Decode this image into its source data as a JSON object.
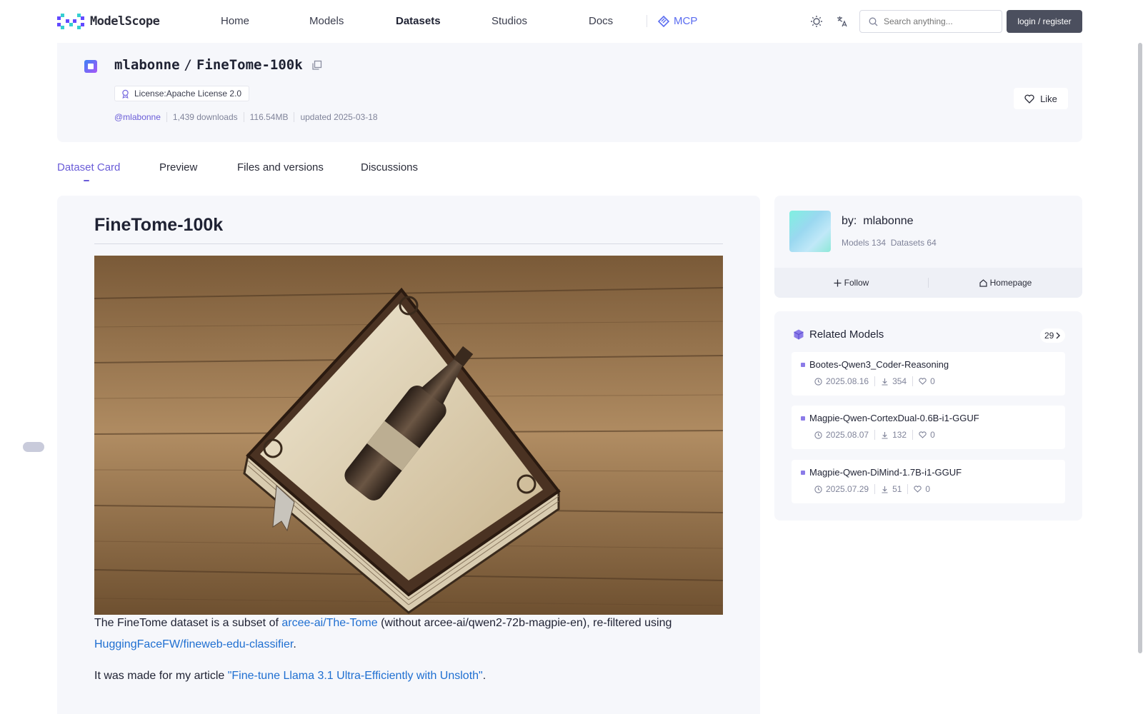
{
  "brand": {
    "name": "ModelScope"
  },
  "nav": {
    "items": [
      {
        "label": "Home"
      },
      {
        "label": "Models"
      },
      {
        "label": "Datasets"
      },
      {
        "label": "Studios"
      },
      {
        "label": "Docs"
      }
    ],
    "mcp_label": "MCP"
  },
  "search": {
    "placeholder": "Search anything..."
  },
  "auth": {
    "login_label": "login / register"
  },
  "dataset": {
    "owner": "mlabonne",
    "separator": "/",
    "name": "FineTome-100k",
    "license": "License:Apache License 2.0",
    "author_handle": "@mlabonne",
    "downloads": "1,439 downloads",
    "size": "116.54MB",
    "updated": "updated 2025-03-18",
    "like_label": "Like"
  },
  "tabs": [
    {
      "label": "Dataset Card"
    },
    {
      "label": "Preview"
    },
    {
      "label": "Files and versions"
    },
    {
      "label": "Discussions"
    }
  ],
  "card": {
    "title": "FineTome-100k",
    "p1_a": "The FineTome dataset is a subset of ",
    "p1_link1": "arcee-ai/The-Tome",
    "p1_b": " (without arcee-ai/qwen2-72b-magpie-en), re-filtered using ",
    "p1_link2": "HuggingFaceFW/fineweb-edu-classifier",
    "p1_c": ".",
    "p2_a": "It was made for my article ",
    "p2_link": "\"Fine-tune Llama 3.1 Ultra-Efficiently with Unsloth\"",
    "p2_b": "."
  },
  "author": {
    "by_label": "by:",
    "name": "mlabonne",
    "models": "Models 134",
    "datasets": "Datasets 64",
    "follow_label": "Follow",
    "homepage_label": "Homepage"
  },
  "related": {
    "title": "Related Models",
    "count": "29",
    "items": [
      {
        "name": "Bootes-Qwen3_Coder-Reasoning",
        "date": "2025.08.16",
        "downloads": "354",
        "likes": "0"
      },
      {
        "name": "Magpie-Qwen-CortexDual-0.6B-i1-GGUF",
        "date": "2025.08.07",
        "downloads": "132",
        "likes": "0"
      },
      {
        "name": "Magpie-Qwen-DiMind-1.7B-i1-GGUF",
        "date": "2025.07.29",
        "downloads": "51",
        "likes": "0"
      }
    ]
  },
  "colors": {
    "accent": "#6a5cd8",
    "link": "#1f6fd1",
    "mcp": "#5a6cf0"
  }
}
